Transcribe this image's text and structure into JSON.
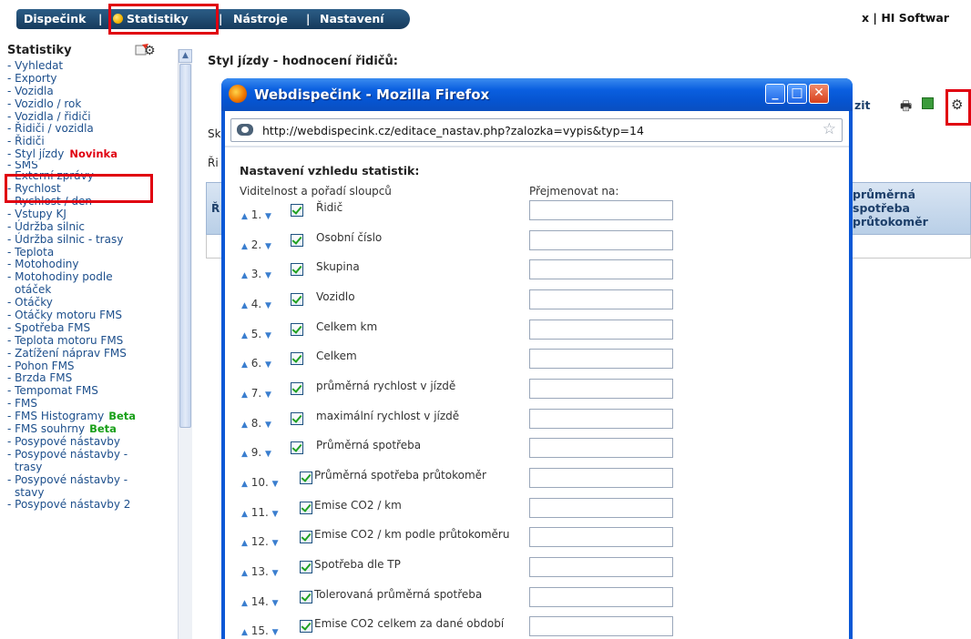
{
  "nav": {
    "items": [
      "Dispečink",
      "Statistiky",
      "Nástroje",
      "Nastavení"
    ],
    "separator": "|",
    "right": "x  |  HI Softwar"
  },
  "sidebar": {
    "title": "Statistiky",
    "items": [
      {
        "label": "- Vyhledat"
      },
      {
        "label": "- Exporty"
      },
      {
        "label": "- Vozidla"
      },
      {
        "label": "- Vozidlo / rok"
      },
      {
        "label": "- Vozidla / řidiči"
      },
      {
        "label": "- Řidiči / vozidla"
      },
      {
        "label": "- Řidiči"
      },
      {
        "label": "- Styl jízdy",
        "badge": "Novinka"
      },
      {
        "label": "- SMS"
      },
      {
        "label": "- Externí zprávy"
      },
      {
        "label": "- Rychlost"
      },
      {
        "label": "- Rychlost / den"
      },
      {
        "label": "- Vstupy KJ"
      },
      {
        "label": "- Údržba silnic"
      },
      {
        "label": "- Údržba silnic - trasy"
      },
      {
        "label": "- Teplota"
      },
      {
        "label": "- Motohodiny"
      },
      {
        "label": "- Motohodiny podle"
      },
      {
        "label": "  otáček"
      },
      {
        "label": "- Otáčky"
      },
      {
        "label": "- Otáčky motoru FMS"
      },
      {
        "label": "- Spotřeba FMS"
      },
      {
        "label": "- Teplota motoru FMS"
      },
      {
        "label": "- Zatížení náprav FMS"
      },
      {
        "label": "- Pohon FMS"
      },
      {
        "label": "- Brzda FMS"
      },
      {
        "label": "- Tempomat FMS"
      },
      {
        "label": "- FMS"
      },
      {
        "label": "- FMS Histogramy",
        "beta": "Beta"
      },
      {
        "label": "- FMS souhrny",
        "beta": "Beta"
      },
      {
        "label": "- Posypové nástavby"
      },
      {
        "label": "- Posypové nástavby -"
      },
      {
        "label": "  trasy"
      },
      {
        "label": "- Posypové nástavby -"
      },
      {
        "label": "  stavy"
      },
      {
        "label": "- Posypové nástavby 2"
      }
    ]
  },
  "page": {
    "title": "Styl jízdy - hodnocení řidičů:",
    "toolbar_text": "zit",
    "sk": "Sk",
    "ri": "Ři",
    "row_header_r": "Ř",
    "col_header": [
      "průměrná",
      "spotřeba",
      "průtokoměr"
    ]
  },
  "popup": {
    "title": "Webdispečink - Mozilla Firefox",
    "url": "http://webdispecink.cz/editace_nastav.php?zalozka=vypis&typ=14",
    "heading": "Nastavení vzhledu statistik:",
    "col_visibility": "Viditelnost a pořadí sloupců",
    "col_rename": "Přejmenovat na:",
    "rows": [
      {
        "n": "1.",
        "label": "Řidič"
      },
      {
        "n": "2.",
        "label": "Osobní číslo"
      },
      {
        "n": "3.",
        "label": "Skupina"
      },
      {
        "n": "4.",
        "label": "Vozidlo"
      },
      {
        "n": "5.",
        "label": "Celkem km"
      },
      {
        "n": "6.",
        "label": "Celkem"
      },
      {
        "n": "7.",
        "label": "průměrná rychlost v jízdě"
      },
      {
        "n": "8.",
        "label": "maximální rychlost v jízdě"
      },
      {
        "n": "9.",
        "label": "Průměrná spotřeba"
      },
      {
        "n": "10.",
        "label": "Průměrná spotřeba průtokoměr"
      },
      {
        "n": "11.",
        "label": "Emise CO2 / km"
      },
      {
        "n": "12.",
        "label": "Emise CO2 / km podle průtokoměru"
      },
      {
        "n": "13.",
        "label": "Spotřeba dle TP"
      },
      {
        "n": "14.",
        "label": "Tolerovaná průměrná spotřeba"
      },
      {
        "n": "15.",
        "label": "Emise CO2 celkem za dané období"
      }
    ]
  },
  "colors": {
    "nav_bg": "#1e4a70",
    "highlight_red": "#e00010",
    "beta_green": "#1aa01a",
    "popup_titlebar": "#0a5fe0"
  }
}
